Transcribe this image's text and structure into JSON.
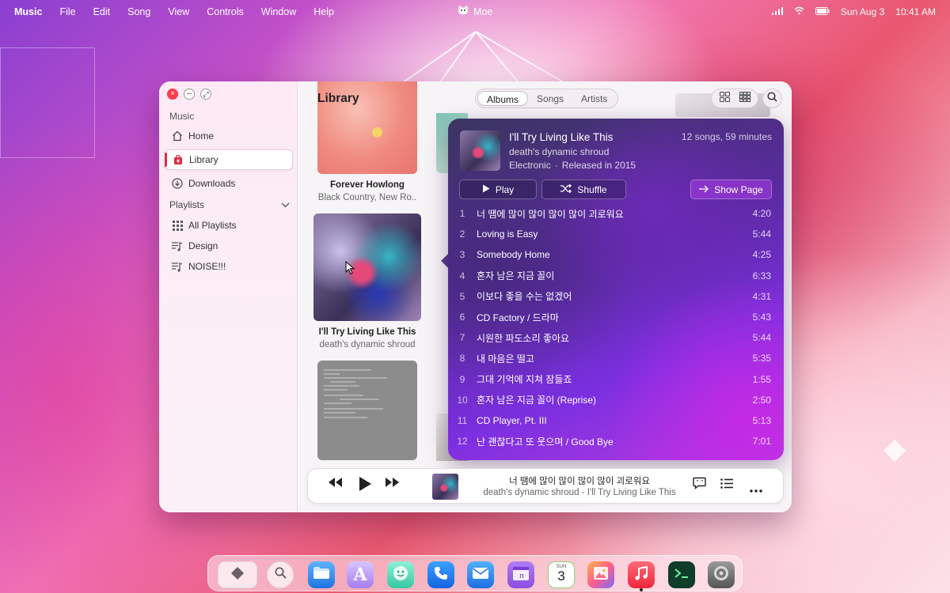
{
  "menubar": {
    "app": "Music",
    "items": [
      "File",
      "Edit",
      "Song",
      "View",
      "Controls",
      "Window",
      "Help"
    ],
    "center_label": "Moe",
    "date": "Sun Aug 3",
    "time": "10:41 AM"
  },
  "sidebar": {
    "title": "Music",
    "items": [
      {
        "label": "Home",
        "icon": "house-icon"
      },
      {
        "label": "Library",
        "icon": "library-bag-icon",
        "active": true
      },
      {
        "label": "Downloads",
        "icon": "download-icon"
      }
    ],
    "playlists_label": "Playlists",
    "playlists": [
      {
        "label": "All Playlists",
        "icon": "grid-icon"
      },
      {
        "label": "Design",
        "icon": "playlist-icon"
      },
      {
        "label": "NOISE!!!",
        "icon": "playlist-icon"
      }
    ],
    "accent": "#e12a3e"
  },
  "main": {
    "title": "Library",
    "tabs": [
      "Albums",
      "Songs",
      "Artists"
    ],
    "active_tab": "Albums",
    "albums": [
      {
        "title": "Forever Howlong",
        "artist": "Black Country, New Ro.."
      },
      {
        "title": "I'll Try Living Like This",
        "artist": "death's dynamic shroud"
      }
    ]
  },
  "popover": {
    "title": "I'll Try Living Like This",
    "artist": "death's dynamic shroud",
    "genre": "Electronic",
    "separator": "·",
    "released": "Released in 2015",
    "summary": "12 songs, 59 minutes",
    "play_label": "Play",
    "shuffle_label": "Shuffle",
    "show_page_label": "Show Page",
    "tracks": [
      {
        "n": "1",
        "name": "너 땜에 많이 많이 많이 많이 괴로워요",
        "dur": "4:20"
      },
      {
        "n": "2",
        "name": "Loving is Easy",
        "dur": "5:44"
      },
      {
        "n": "3",
        "name": "Somebody Home",
        "dur": "4:25"
      },
      {
        "n": "4",
        "name": "혼자 남은 지금 꼴이",
        "dur": "6:33"
      },
      {
        "n": "5",
        "name": "이보다 좋을 수는 없겠어",
        "dur": "4:31"
      },
      {
        "n": "6",
        "name": "CD Factory / 드라마",
        "dur": "5:43"
      },
      {
        "n": "7",
        "name": "시원한 파도소리 좋아요",
        "dur": "5:44"
      },
      {
        "n": "8",
        "name": "내 마음은 떨고",
        "dur": "5:35"
      },
      {
        "n": "9",
        "name": "그대 기억에 지쳐 잠들죠",
        "dur": "1:55"
      },
      {
        "n": "10",
        "name": "혼자 남은 지금 꼴이 (Reprise)",
        "dur": "2:50"
      },
      {
        "n": "11",
        "name": "CD Player, Pt. III",
        "dur": "5:13"
      },
      {
        "n": "12",
        "name": "난 괜찮다고 또 웃으며 / Good Bye",
        "dur": "7:01"
      }
    ]
  },
  "player": {
    "title": "너 땜에 많이 많이 많이 많이 괴로워요",
    "subtitle": "death's dynamic shroud - I'll Try Living Like This"
  },
  "dock": {
    "calendar_month": "SUN",
    "calendar_day": "3",
    "items": [
      "launcher-icon",
      "search-icon",
      "folder-icon",
      "editor-icon",
      "messages-icon",
      "phone-icon",
      "mail-icon",
      "notes-icon",
      "calendar-icon",
      "photos-icon",
      "music-icon",
      "terminal-icon",
      "settings-icon"
    ]
  }
}
